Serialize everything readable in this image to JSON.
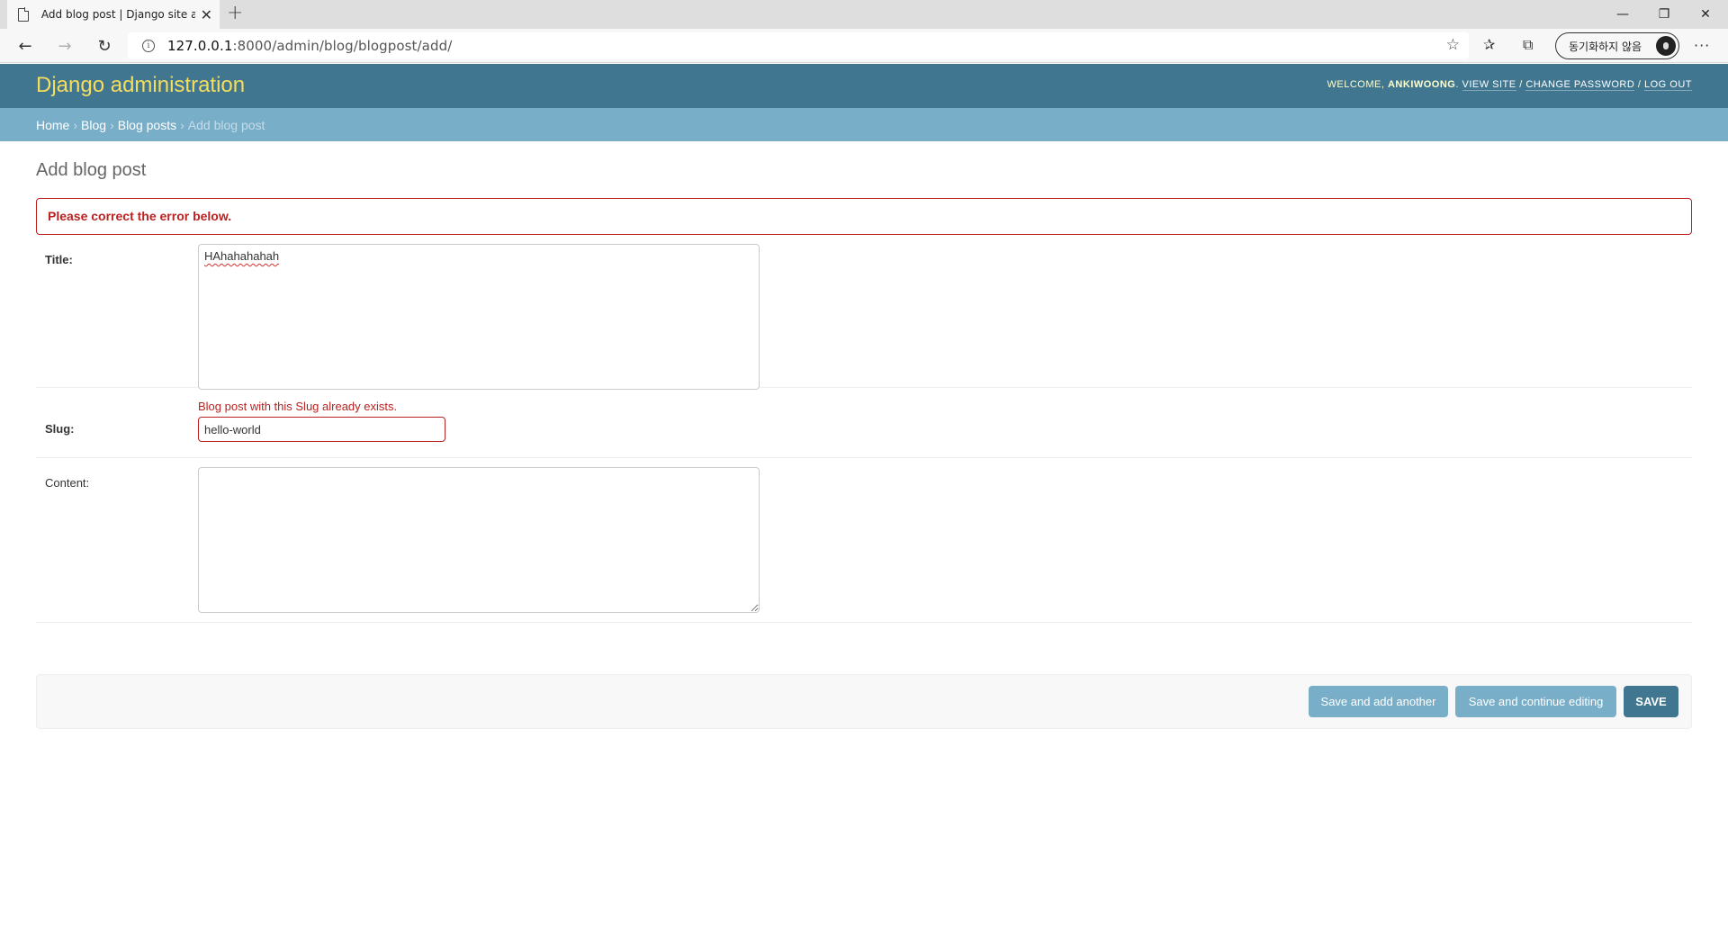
{
  "browser": {
    "tab_title": "Add blog post | Django site adm",
    "url_host": "127.0.0.1",
    "url_rest": ":8000/admin/blog/blogpost/add/",
    "sync_label": "동기화하지 않음"
  },
  "header": {
    "branding": "Django administration",
    "welcome": "Welcome,",
    "username": "ankiwoong",
    "view_site": "View site",
    "change_password": "Change password",
    "log_out": "Log out",
    "sep": "/"
  },
  "breadcrumbs": {
    "home": "Home",
    "app": "Blog",
    "model": "Blog posts",
    "current": "Add blog post"
  },
  "page": {
    "title": "Add blog post",
    "errornote": "Please correct the error below."
  },
  "form": {
    "title_label": "Title:",
    "title_value": "HAhahahahah",
    "slug_error": "Blog post with this Slug already exists.",
    "slug_label": "Slug:",
    "slug_value": "hello-world",
    "content_label": "Content:",
    "content_value": ""
  },
  "submit": {
    "save_add_another": "Save and add another",
    "save_continue": "Save and continue editing",
    "save": "Save"
  },
  "colors": {
    "header_bg": "#417690",
    "branding": "#f5dd5d",
    "breadcrumbs_bg": "#79aec8",
    "error": "#ba2121"
  }
}
